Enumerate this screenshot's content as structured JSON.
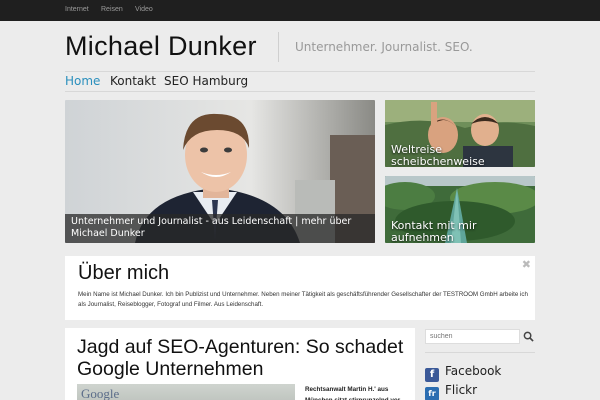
{
  "topnav": [
    "Internet",
    "Reisen",
    "Video"
  ],
  "header": {
    "title": "Michael Dunker",
    "tagline": "Unternehmer. Journalist. SEO."
  },
  "mainnav": {
    "items": [
      "Home",
      "Kontakt",
      "SEO Hamburg"
    ],
    "active_index": 0
  },
  "featured": {
    "main_caption": "Unternehmer und Journalist - aus Leidenschaft | mehr über Michael Dunker",
    "side1_caption": "Weltreise scheibchenweise",
    "side2_caption": "Kontakt mit mir aufnehmen"
  },
  "about": {
    "heading": "Über mich",
    "text": "Mein Name ist Michael Dunker. Ich bin Publizist und Unternehmer. Neben meiner Tätigkeit als geschäftsführender Gesellschafter der TESTROOM GmbH arbeite ich als Journalist, Reiseblogger, Fotograf und Filmer. Aus Leidenschaft.",
    "close": "✖"
  },
  "post": {
    "title": "Jagd auf SEO-Agenturen: So schadet Google Unternehmen",
    "thumb_text": "Google",
    "excerpt": "Rechtsanwalt Martin H.' aus München sitzt stirnrunzelnd vor"
  },
  "sidebar": {
    "search_placeholder": "suchen",
    "social": [
      {
        "label": "Facebook",
        "icon": "facebook-icon"
      },
      {
        "label": "Flickr",
        "icon": "flickr-icon"
      }
    ]
  },
  "colors": {
    "accent": "#2a8fbd",
    "topbar": "#1f1f1f",
    "background": "#ececec"
  }
}
